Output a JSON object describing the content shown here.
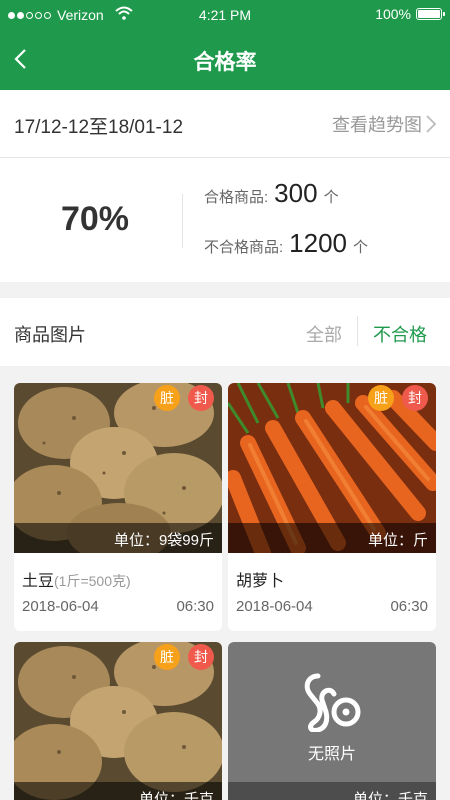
{
  "status_bar": {
    "carrier": "Verizon",
    "time": "4:21 PM",
    "battery": "100%"
  },
  "nav": {
    "title": "合格率"
  },
  "date_row": {
    "range": "17/12-12至18/01-12",
    "trend_label": "查看趋势图"
  },
  "stats": {
    "pass_rate": "70%",
    "qualified_label": "合格商品:",
    "qualified_count": "300",
    "qualified_unit": "个",
    "unqualified_label": "不合格商品:",
    "unqualified_count": "1200",
    "unqualified_unit": "个"
  },
  "section": {
    "title": "商品图片",
    "filter_all": "全部",
    "filter_unqualified": "不合格"
  },
  "badges": {
    "dirty": "脏",
    "sealed": "封"
  },
  "products": [
    {
      "name": "土豆",
      "spec": "(1斤=500克)",
      "unit": "单位：9袋99斤",
      "date": "2018-06-04",
      "time": "06:30"
    },
    {
      "name": "胡萝卜",
      "spec": "",
      "unit": "单位：斤",
      "date": "2018-06-04",
      "time": "06:30"
    },
    {
      "unit": "单位：千克"
    },
    {
      "unit": "单位：千克",
      "no_photo_label": "无照片"
    }
  ],
  "colors": {
    "brand_green": "#1f9a4c",
    "badge_orange": "#f7a11a",
    "badge_red": "#ef5a4c"
  }
}
